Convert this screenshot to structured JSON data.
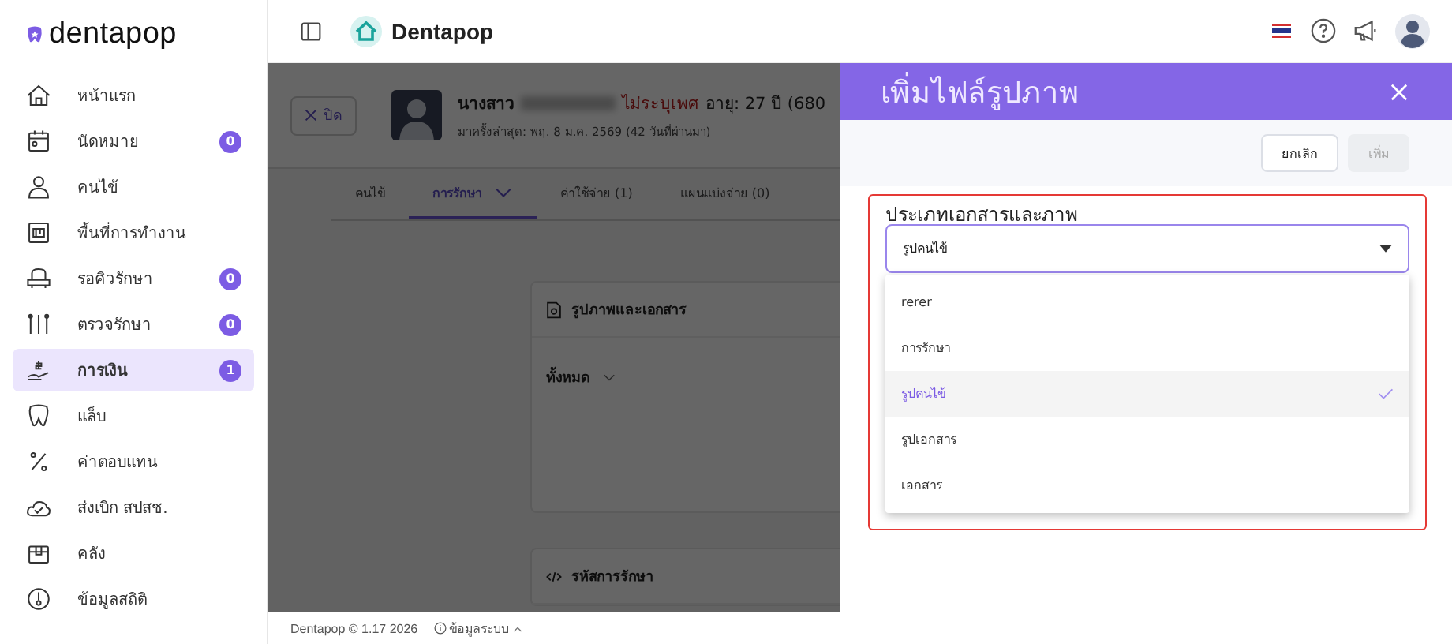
{
  "brand": {
    "name": "dentapop"
  },
  "header": {
    "title": "Dentapop"
  },
  "sidebar": {
    "items": [
      {
        "label": "หน้าแรก",
        "selected": false
      },
      {
        "label": "นัดหมาย",
        "badge": "0",
        "selected": false
      },
      {
        "label": "คนไข้",
        "selected": false
      },
      {
        "label": "พื้นที่การทำงาน",
        "selected": false
      },
      {
        "label": "รอคิวรักษา",
        "badge": "0",
        "selected": false
      },
      {
        "label": "ตรวจรักษา",
        "badge": "0",
        "selected": false
      },
      {
        "label": "การเงิน",
        "badge": "1",
        "selected": true
      },
      {
        "label": "แล็บ",
        "selected": false
      },
      {
        "label": "ค่าตอบแทน",
        "selected": false
      },
      {
        "label": "ส่งเบิก สปสช.",
        "selected": false
      },
      {
        "label": "คลัง",
        "selected": false
      },
      {
        "label": "ข้อมูลสถิติ",
        "selected": false
      }
    ]
  },
  "patient": {
    "close": "ปิด",
    "prefix": "นางสาว",
    "gender": "ไม่ระบุเพศ",
    "age": "อายุ: 27 ปี (680",
    "last_visit": "มาครั้งล่าสุด: พฤ. 8 ม.ค. 2569 (42 วันที่ผ่านมา)"
  },
  "tabs": [
    {
      "label": "คนไข้",
      "selected": false
    },
    {
      "label": "การรักษา",
      "selected": true,
      "dropdown": true
    },
    {
      "label": "ค่าใช้จ่าย (1)",
      "selected": false
    },
    {
      "label": "แผนแบ่งจ่าย (0)",
      "selected": false
    }
  ],
  "sections": [
    {
      "kind": "documents",
      "title": "รูปภาพและเอกสาร",
      "filter": "ทั้งหมด"
    },
    {
      "kind": "codes",
      "title": "รหัสการรักษา"
    }
  ],
  "drawer": {
    "title": "เพิ่มไฟล์รูปภาพ",
    "cancel": "ยกเลิก",
    "submit": {
      "label": "เพิ่ม",
      "disabled": true
    },
    "invalid": true,
    "field_label": "ประเภทเอกสารและภาพ",
    "value": "รูปคนไข้",
    "options": [
      {
        "label": "rerer",
        "selected": false
      },
      {
        "label": "การรักษา",
        "selected": false
      },
      {
        "label": "รูปคนไข้",
        "selected": true
      },
      {
        "label": "รูปเอกสาร",
        "selected": false
      },
      {
        "label": "เอกสาร",
        "selected": false
      }
    ]
  },
  "footer": {
    "copyright": "Dentapop © 1.17 2026",
    "info": "ข้อมูลระบบ"
  }
}
